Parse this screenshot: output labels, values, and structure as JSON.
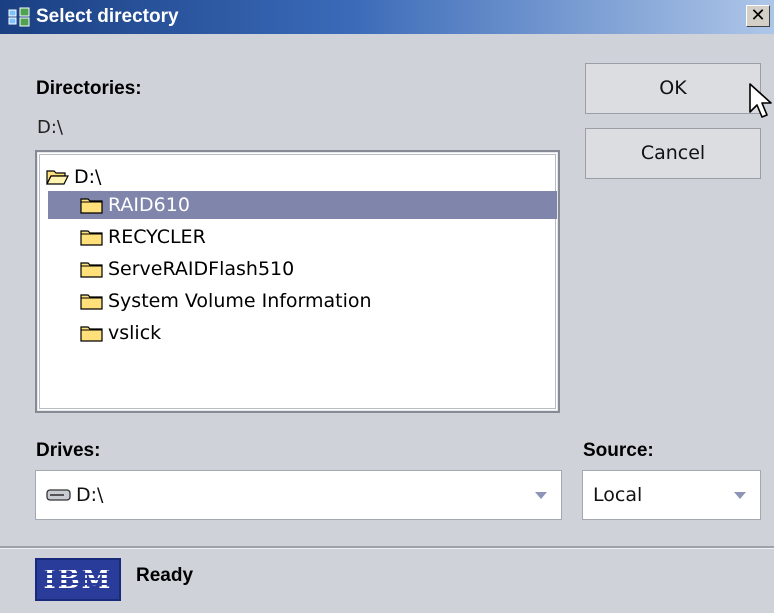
{
  "window": {
    "title": "Select directory",
    "close_glyph": "✕"
  },
  "directories": {
    "label": "Directories:",
    "current_path": "D:\\",
    "tree": {
      "root": "D:\\",
      "items": [
        "RAID610",
        "RECYCLER",
        "ServeRAIDFlash510",
        "System Volume Information",
        "vslick"
      ],
      "selected": "RAID610"
    }
  },
  "buttons": {
    "ok": "OK",
    "cancel": "Cancel"
  },
  "drives": {
    "label": "Drives:",
    "value": "D:\\"
  },
  "source": {
    "label": "Source:",
    "value": "Local"
  },
  "status": {
    "logo": "IBM",
    "text": "Ready"
  },
  "colors": {
    "selection": "#7f85ab",
    "titlebar_start": "#1a3f82",
    "folder": "#ffe07a"
  }
}
